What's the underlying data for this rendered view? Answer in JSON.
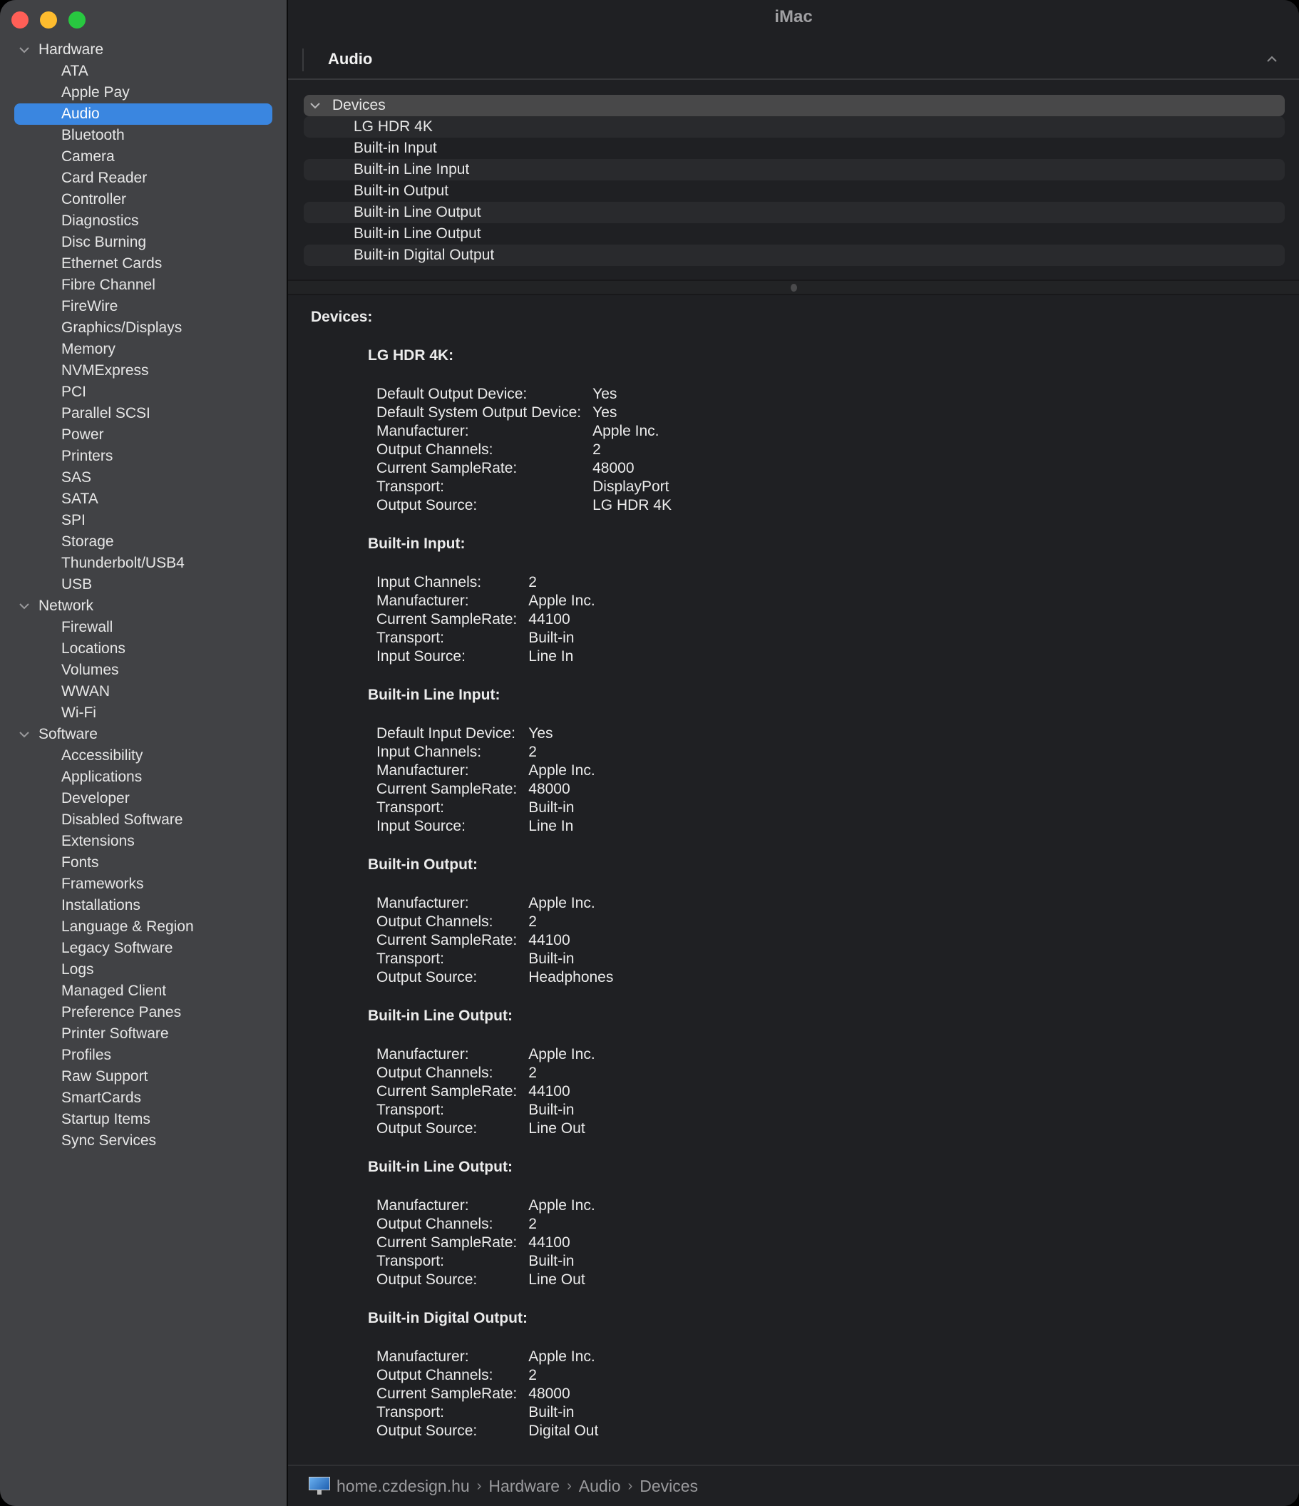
{
  "window": {
    "title": "iMac",
    "traffic_lights": {
      "close": "#ff5f57",
      "minimize": "#febc2e",
      "maximize": "#28c840"
    }
  },
  "sidebar": {
    "selected": "Audio",
    "groups": [
      {
        "label": "Hardware",
        "items": [
          "ATA",
          "Apple Pay",
          "Audio",
          "Bluetooth",
          "Camera",
          "Card Reader",
          "Controller",
          "Diagnostics",
          "Disc Burning",
          "Ethernet Cards",
          "Fibre Channel",
          "FireWire",
          "Graphics/Displays",
          "Memory",
          "NVMExpress",
          "PCI",
          "Parallel SCSI",
          "Power",
          "Printers",
          "SAS",
          "SATA",
          "SPI",
          "Storage",
          "Thunderbolt/USB4",
          "USB"
        ]
      },
      {
        "label": "Network",
        "items": [
          "Firewall",
          "Locations",
          "Volumes",
          "WWAN",
          "Wi-Fi"
        ]
      },
      {
        "label": "Software",
        "items": [
          "Accessibility",
          "Applications",
          "Developer",
          "Disabled Software",
          "Extensions",
          "Fonts",
          "Frameworks",
          "Installations",
          "Language & Region",
          "Legacy Software",
          "Logs",
          "Managed Client",
          "Preference Panes",
          "Printer Software",
          "Profiles",
          "Raw Support",
          "SmartCards",
          "Startup Items",
          "Sync Services"
        ]
      }
    ]
  },
  "section": {
    "title": "Audio",
    "collapse_icon": "chevron-up-icon"
  },
  "tree": {
    "header": "Devices",
    "items": [
      "LG HDR 4K",
      "Built-in Input",
      "Built-in Line Input",
      "Built-in Output",
      "Built-in Line Output",
      "Built-in Line Output",
      "Built-in Digital Output"
    ]
  },
  "detail": {
    "title": "Devices:",
    "devices": [
      {
        "name": "LG HDR 4K:",
        "props": [
          [
            "Default Output Device:",
            "Yes"
          ],
          [
            "Default System Output Device:",
            "Yes"
          ],
          [
            "Manufacturer:",
            "Apple Inc."
          ],
          [
            "Output Channels:",
            "2"
          ],
          [
            "Current SampleRate:",
            "48000"
          ],
          [
            "Transport:",
            "DisplayPort"
          ],
          [
            "Output Source:",
            "LG HDR 4K"
          ]
        ]
      },
      {
        "name": "Built-in Input:",
        "props": [
          [
            "Input Channels:",
            "2"
          ],
          [
            "Manufacturer:",
            "Apple Inc."
          ],
          [
            "Current SampleRate:",
            "44100"
          ],
          [
            "Transport:",
            "Built-in"
          ],
          [
            "Input Source:",
            "Line In"
          ]
        ]
      },
      {
        "name": "Built-in Line Input:",
        "props": [
          [
            "Default Input Device:",
            "Yes"
          ],
          [
            "Input Channels:",
            "2"
          ],
          [
            "Manufacturer:",
            "Apple Inc."
          ],
          [
            "Current SampleRate:",
            "48000"
          ],
          [
            "Transport:",
            "Built-in"
          ],
          [
            "Input Source:",
            "Line In"
          ]
        ]
      },
      {
        "name": "Built-in Output:",
        "props": [
          [
            "Manufacturer:",
            "Apple Inc."
          ],
          [
            "Output Channels:",
            "2"
          ],
          [
            "Current SampleRate:",
            "44100"
          ],
          [
            "Transport:",
            "Built-in"
          ],
          [
            "Output Source:",
            "Headphones"
          ]
        ]
      },
      {
        "name": "Built-in Line Output:",
        "props": [
          [
            "Manufacturer:",
            "Apple Inc."
          ],
          [
            "Output Channels:",
            "2"
          ],
          [
            "Current SampleRate:",
            "44100"
          ],
          [
            "Transport:",
            "Built-in"
          ],
          [
            "Output Source:",
            "Line Out"
          ]
        ]
      },
      {
        "name": "Built-in Line Output:",
        "props": [
          [
            "Manufacturer:",
            "Apple Inc."
          ],
          [
            "Output Channels:",
            "2"
          ],
          [
            "Current SampleRate:",
            "44100"
          ],
          [
            "Transport:",
            "Built-in"
          ],
          [
            "Output Source:",
            "Line Out"
          ]
        ]
      },
      {
        "name": "Built-in Digital Output:",
        "props": [
          [
            "Manufacturer:",
            "Apple Inc."
          ],
          [
            "Output Channels:",
            "2"
          ],
          [
            "Current SampleRate:",
            "48000"
          ],
          [
            "Transport:",
            "Built-in"
          ],
          [
            "Output Source:",
            "Digital Out"
          ]
        ]
      }
    ]
  },
  "footer": {
    "icon": "imac-icon",
    "breadcrumb": [
      "home.czdesign.hu",
      "Hardware",
      "Audio",
      "Devices"
    ],
    "separator": "›"
  },
  "colors": {
    "accent": "#3a86e0",
    "sidebar_bg": "#414245",
    "content_bg": "#1f2023"
  }
}
